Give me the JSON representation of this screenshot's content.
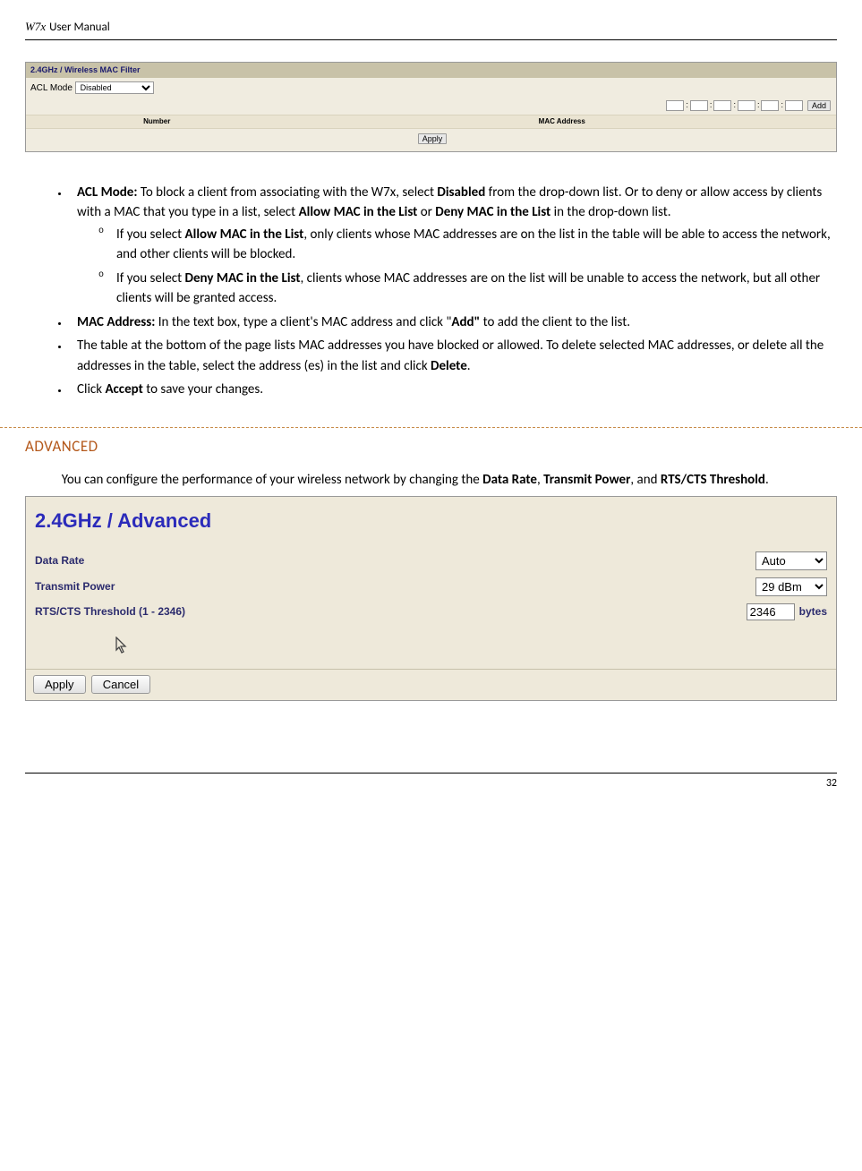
{
  "header": {
    "prefix": "W7x",
    "rest": "User Manual"
  },
  "filterPanel": {
    "title": "2.4GHz / Wireless MAC Filter",
    "aclLabel": "ACL Mode",
    "aclValue": "Disabled",
    "addBtn": "Add",
    "tableHeaders": {
      "number": "Number",
      "mac": "MAC Address"
    },
    "applyBtn": "Apply"
  },
  "bullets": {
    "aclMode": {
      "label": "ACL Mode:",
      "text": " To block a client from associating with the W7x, select ",
      "b1": "Disabled",
      "text2": " from the drop-down list. Or to deny or allow access by clients with a MAC that you type in a list, select ",
      "b2": "Allow MAC in the List",
      "text3": " or ",
      "b3": "Deny MAC in the List",
      "text4": " in the drop-down list."
    },
    "sub1": {
      "pre": "If you select ",
      "b": "Allow MAC in the List",
      "post": ", only clients whose MAC addresses are on the list in the table will be able to access the network, and other clients will be blocked."
    },
    "sub2": {
      "pre": "If you select ",
      "b": "Deny MAC in the List",
      "post": ", clients whose MAC addresses are on the list will be unable to access the network, but all other clients will be granted access."
    },
    "macAddr": {
      "label": "MAC Address:",
      "text1": " In the text box, type a client's MAC address and click \"",
      "b1": "Add\"",
      "text2": " to add the client to the list."
    },
    "tableNote": {
      "text1": "The table at the bottom of the page lists MAC addresses you have blocked or allowed. To delete selected MAC addresses, or delete all the addresses in the table, select the address (es) in the list and click ",
      "b1": "Delete",
      "text2": "."
    },
    "accept": {
      "text1": "Click ",
      "b1": "Accept",
      "text2": " to save your changes."
    }
  },
  "advancedSection": {
    "heading": "ADVANCED",
    "intro1": "You can configure the performance of your wireless network by changing the ",
    "b1": "Data Rate",
    "c1": ", ",
    "b2": "Transmit Power",
    "c2": ", and ",
    "b3": "RTS/CTS Threshold",
    "c3": "."
  },
  "advancedPanel": {
    "title": "2.4GHz / Advanced",
    "rows": {
      "dataRateLabel": "Data Rate",
      "dataRateValue": "Auto",
      "txPowerLabel": "Transmit Power",
      "txPowerValue": "29 dBm",
      "rtsLabel": "RTS/CTS Threshold (1 - 2346)",
      "rtsValue": "2346",
      "rtsUnit": "bytes"
    },
    "applyBtn": "Apply",
    "cancelBtn": "Cancel"
  },
  "footer": {
    "pageNum": "32"
  }
}
